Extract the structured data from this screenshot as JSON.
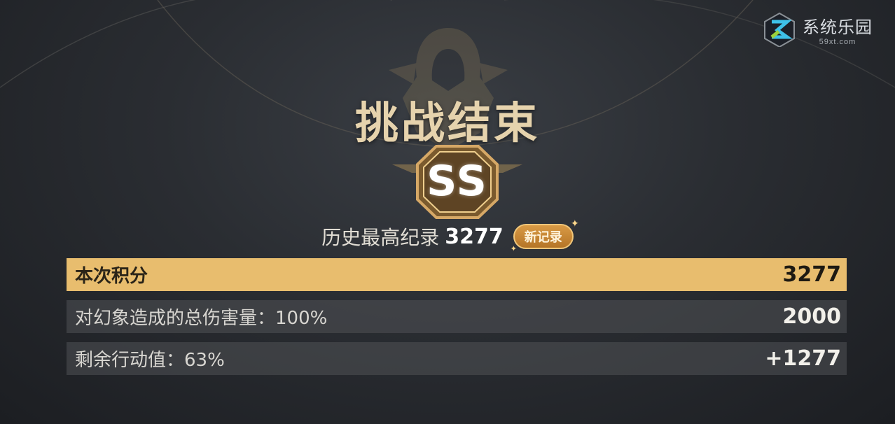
{
  "watermark": {
    "title": "系统乐园",
    "subtitle": "59xt.com"
  },
  "title": "挑战结束",
  "grade": "SS",
  "record": {
    "label": "历史最高纪录",
    "value": "3277",
    "badge": "新记录"
  },
  "score_rows": [
    {
      "label": "本次积分",
      "value": "3277"
    },
    {
      "label": "对幻象造成的总伤害量：100%",
      "value": "2000"
    },
    {
      "label": "剩余行动值：63%",
      "value": "+1277"
    }
  ],
  "colors": {
    "accent_gold": "#e8bd6e",
    "title_gold": "#e6d3ad",
    "badge_orange": "#c98a38"
  }
}
